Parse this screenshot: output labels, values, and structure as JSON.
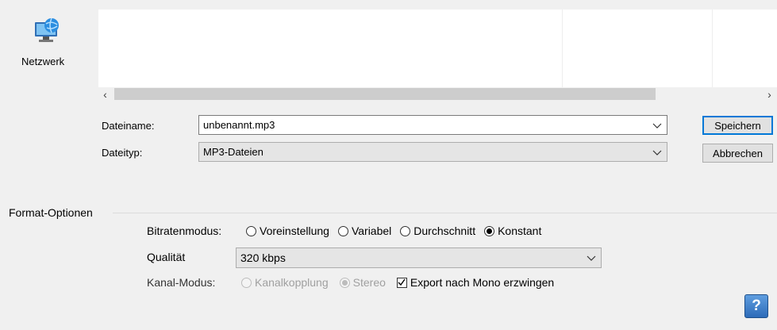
{
  "nav": {
    "network_label": "Netzwerk"
  },
  "file": {
    "name_label": "Dateiname:",
    "name_value": "unbenannt.mp3",
    "type_label": "Dateityp:",
    "type_value": "MP3-Dateien"
  },
  "buttons": {
    "save": "Speichern",
    "cancel": "Abbrechen"
  },
  "format": {
    "group_title": "Format-Optionen",
    "bitrate_label": "Bitratenmodus:",
    "bitrate_options": [
      "Voreinstellung",
      "Variabel",
      "Durchschnitt",
      "Konstant"
    ],
    "bitrate_selected": "Konstant",
    "quality_label": "Qualität",
    "quality_value": "320 kbps",
    "channel_label": "Kanal-Modus:",
    "channel_options": [
      "Kanalkopplung",
      "Stereo"
    ],
    "channel_selected": "Stereo",
    "mono_label": "Export nach Mono erzwingen",
    "mono_checked": true
  },
  "help": {
    "label": "?"
  },
  "colors": {
    "accent": "#0078d7",
    "help_blue": "#2d6bb8"
  },
  "icons": [
    "network-icon",
    "chevron-left-icon",
    "chevron-right-icon",
    "chevron-down-icon",
    "help-icon"
  ]
}
